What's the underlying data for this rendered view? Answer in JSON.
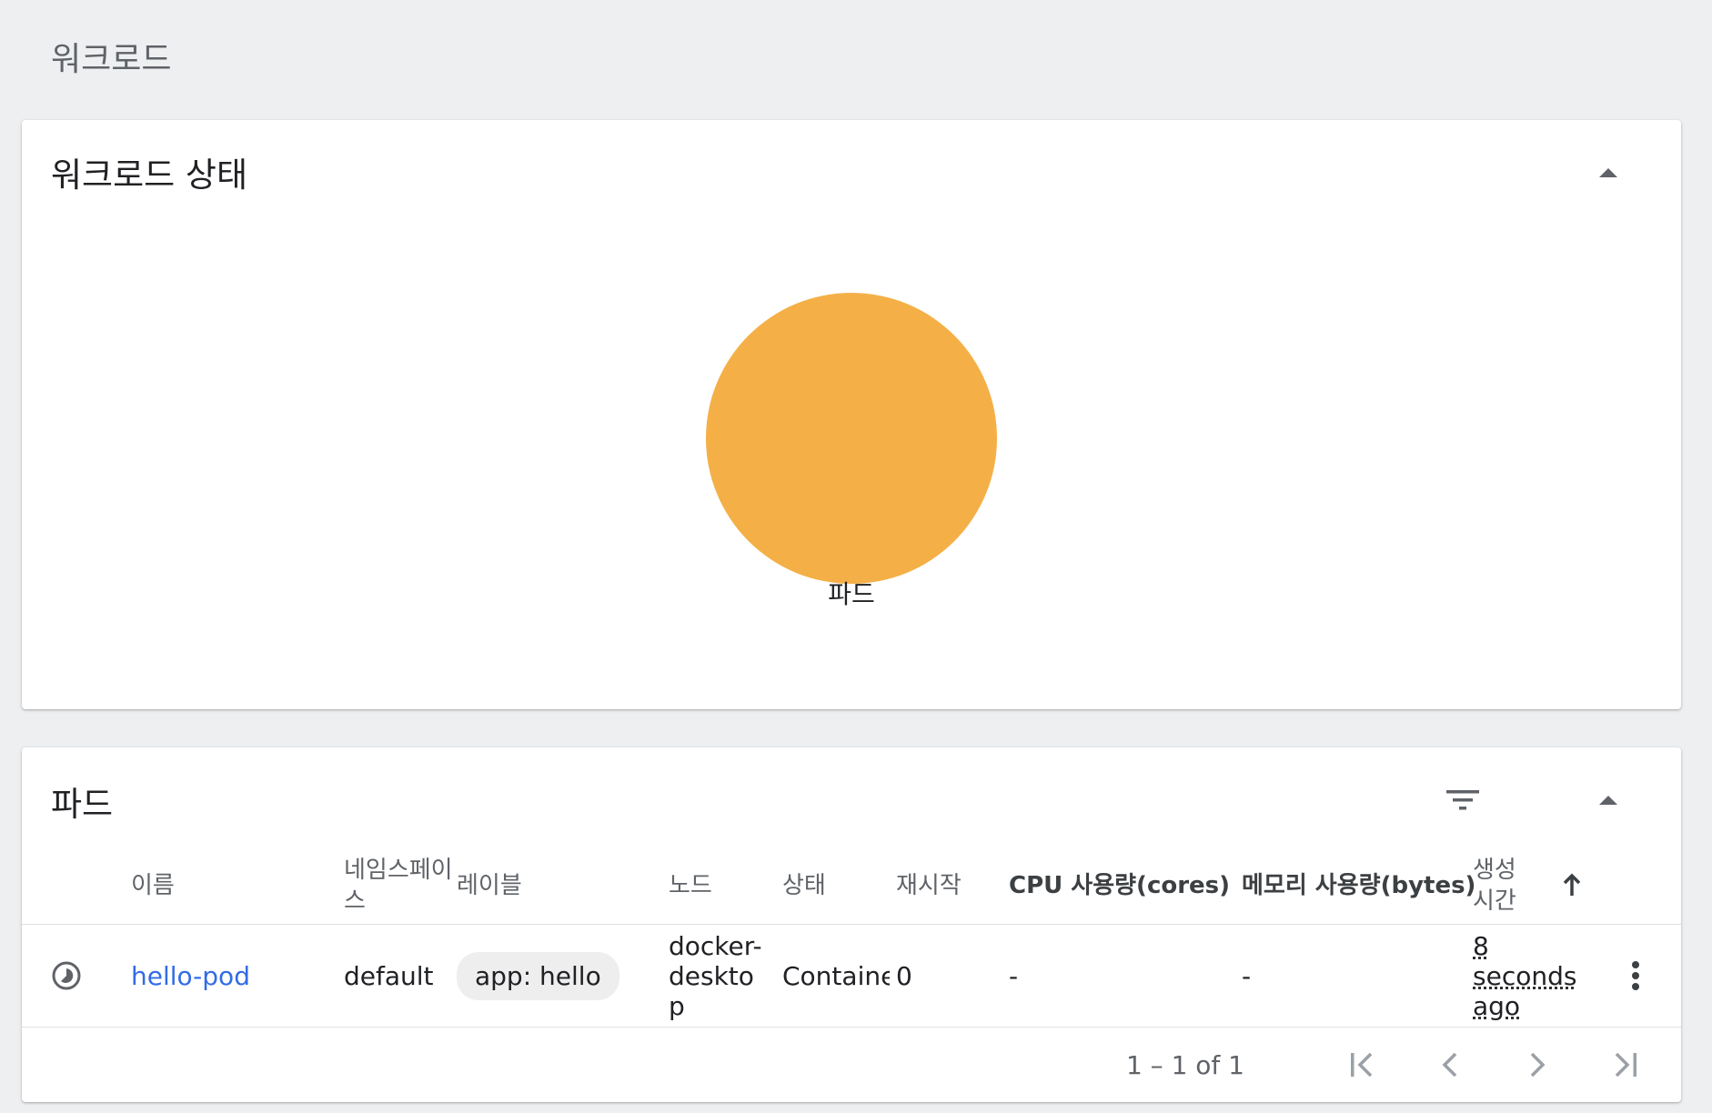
{
  "page": {
    "title": "워크로드"
  },
  "workload_status": {
    "title": "워크로드 상태",
    "chart": {
      "label": "파드",
      "color": "#f4b047"
    }
  },
  "pods": {
    "title": "파드",
    "columns": {
      "name": "이름",
      "namespace": "네임스페이스",
      "labels": "레이블",
      "node": "노드",
      "status": "상태",
      "restarts": "재시작",
      "cpu": "CPU 사용량(cores)",
      "memory": "메모리 사용량(bytes)",
      "created": "생성 시간"
    },
    "rows": [
      {
        "name": "hello-pod",
        "namespace": "default",
        "label": "app: hello",
        "node": "docker-desktop",
        "status": "ContainerCreating",
        "restarts": "0",
        "cpu": "-",
        "memory": "-",
        "created": "8 seconds ago"
      }
    ],
    "pagination": {
      "range": "1 – 1 of 1"
    }
  },
  "colors": {
    "accent_link": "#326ce5",
    "chart_fill": "#f4b047",
    "background": "#eeeff1"
  },
  "icons": {
    "collapse": "triangle-up-icon",
    "filter": "filter-icon",
    "status": "pending-clock-icon",
    "sort": "arrow-up-icon",
    "row_menu": "more-vert-icon",
    "first": "first-page-icon",
    "prev": "chevron-left-icon",
    "next": "chevron-right-icon",
    "last": "last-page-icon"
  }
}
